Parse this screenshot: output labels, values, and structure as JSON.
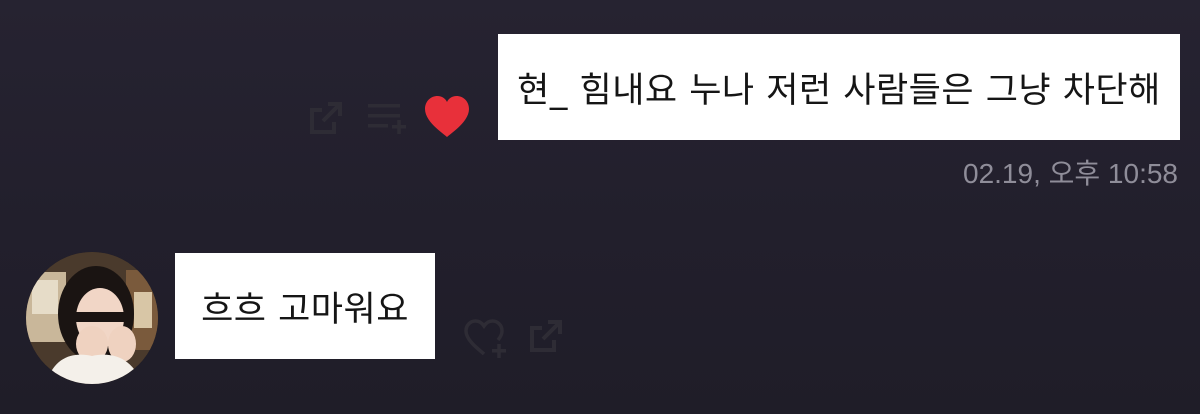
{
  "messages": {
    "sent": {
      "text": "현_ 힘내요 누나 저런 사람들은 그냥 차단해",
      "timestamp": "02.19, 오후 10:58",
      "actions": {
        "share_icon": "share-icon",
        "add_to_list_icon": "add-to-list-icon",
        "like_icon": "heart-filled-icon"
      },
      "liked": true,
      "like_color": "#e8303a"
    },
    "received": {
      "text": "흐흐 고마워요",
      "actions": {
        "like_icon": "heart-add-icon",
        "share_icon": "share-icon"
      }
    }
  },
  "colors": {
    "background": "#231f2d",
    "bubble": "#ffffff",
    "icon": "#2c2a32",
    "timestamp": "#8f8d99"
  }
}
